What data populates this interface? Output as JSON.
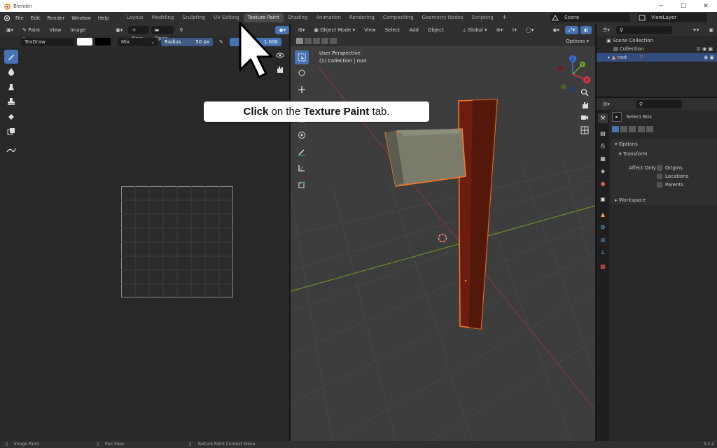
{
  "window": {
    "title": "Blender",
    "buttons": [
      "─",
      "☐",
      "✕"
    ]
  },
  "topbar": {
    "menus": [
      "File",
      "Edit",
      "Render",
      "Window",
      "Help"
    ],
    "workspaces": [
      "Layout",
      "Modeling",
      "Sculpting",
      "UV Editing",
      "Texture Paint",
      "Shading",
      "Animation",
      "Rendering",
      "Compositing",
      "Geometry Nodes",
      "Scripting"
    ],
    "active_workspace": "Texture Paint",
    "add_tab": "+",
    "scene": "Scene",
    "view_layer": "ViewLayer"
  },
  "image_editor": {
    "header": {
      "mode": "Paint",
      "menus": [
        "View",
        "Image"
      ],
      "new_label": "New",
      "open_label": "Open"
    },
    "tool_settings": {
      "brush": "TexDraw",
      "blend": "Mix",
      "radius_label": "Radius",
      "radius_value": "50 px",
      "strength_value": "1.000"
    }
  },
  "viewport": {
    "header": {
      "mode": "Object Mode",
      "menus": [
        "View",
        "Select",
        "Add",
        "Object"
      ],
      "orientation": "Global",
      "options_label": "Options"
    },
    "overlay_text": {
      "line1": "User Perspective",
      "line2": "(1) Collection | root"
    },
    "gizmo": {
      "x": "X",
      "y": "Y",
      "z": "Z"
    }
  },
  "instruction": {
    "click": "Click",
    "middle": " on the ",
    "target": "Texture Paint",
    "end": " tab."
  },
  "outliner": {
    "scene_collection": "Scene Collection",
    "collection": "Collection",
    "object": "root"
  },
  "properties": {
    "tool_name": "Select Box",
    "options_label": "Options",
    "transform_label": "Transform",
    "affect_only_label": "Affect Only",
    "affect_items": [
      "Origins",
      "Locations",
      "Parents"
    ],
    "workspace_label": "Workspace"
  },
  "statusbar": {
    "items": [
      "Image Paint",
      "Pan View",
      "Texture Paint Context Menu"
    ],
    "version": "3.2.2"
  },
  "colors": {
    "accent": "#4772b3",
    "selection_orange": "#ff7a22",
    "background": "#282828"
  }
}
